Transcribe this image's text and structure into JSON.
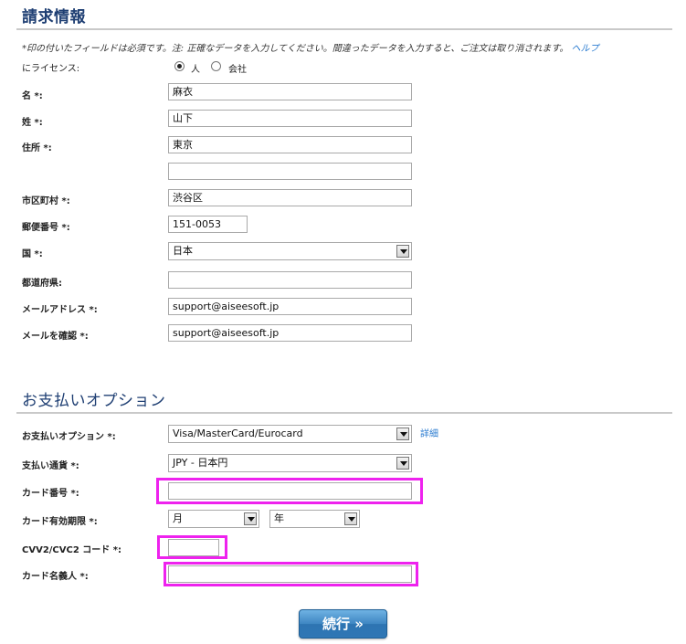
{
  "billing": {
    "title": "請求情報",
    "note": "*印の付いたフィールドは必須です。注: 正確なデータを入力してください。間違ったデータを入力すると、ご注文は取り消されます。",
    "help_link": "ヘルプ",
    "license_label": "にライセンス:",
    "license_options": [
      "人",
      "会社"
    ],
    "license_selected": "人",
    "first_name_label": "名 *:",
    "first_name_value": "麻衣",
    "last_name_label": "姓 *:",
    "last_name_value": "山下",
    "address_label": "住所 *:",
    "address_value": "東京",
    "address2_value": "",
    "city_label": "市区町村 *:",
    "city_value": "渋谷区",
    "postal_label": "郵便番号 *:",
    "postal_value": "151-0053",
    "country_label": "国 *:",
    "country_value": "日本",
    "prefecture_label": "都道府県:",
    "prefecture_value": "",
    "email_label": "メールアドレス *:",
    "email_value": "support@aiseesoft.jp",
    "email_confirm_label": "メールを確認 *:",
    "email_confirm_value": "support@aiseesoft.jp"
  },
  "payment": {
    "title": "お支払いオプション",
    "option_label": "お支払いオプション *:",
    "option_value": "Visa/MasterCard/Eurocard",
    "details_link": "詳細",
    "currency_label": "支払い通貨 *:",
    "currency_value": "JPY - 日本円",
    "card_number_label": "カード番号 *:",
    "card_number_value": "",
    "expiry_label": "カード有効期限 *:",
    "expiry_month": "月",
    "expiry_year": "年",
    "cvv_label": "CVV2/CVC2 コード *:",
    "cvv_value": "",
    "cardholder_label": "カード名義人 *:",
    "cardholder_value": ""
  },
  "continue_button": "続行 »",
  "colors": {
    "title": "#1f3f73",
    "highlight": "#ee22ee",
    "button": "#3e86c2",
    "link": "#2a7bd0"
  },
  "icons": {
    "dropdown": "chevron-down-icon"
  }
}
